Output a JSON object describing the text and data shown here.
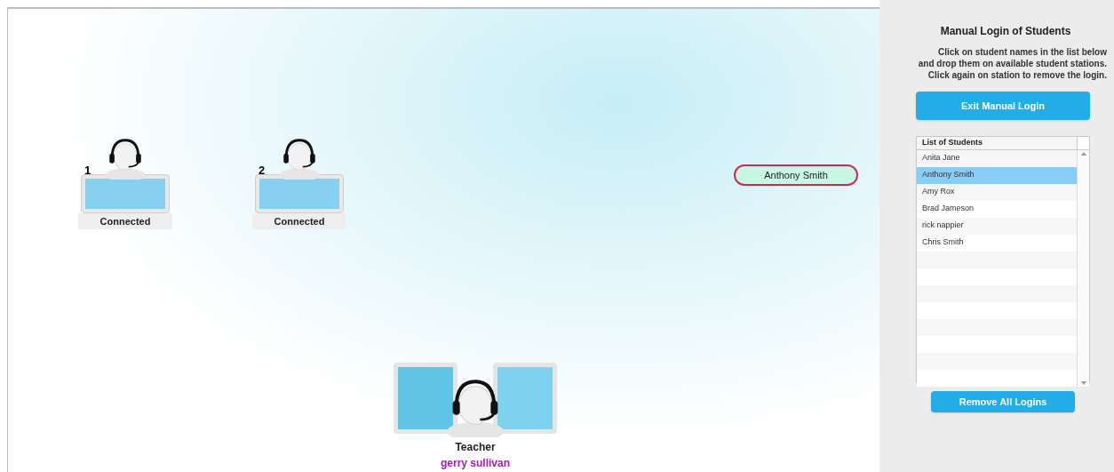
{
  "stations": [
    {
      "number": "1",
      "status": "Connected"
    },
    {
      "number": "2",
      "status": "Connected"
    }
  ],
  "drag_chip": {
    "label": "Anthony Smith"
  },
  "teacher": {
    "role": "Teacher",
    "name": "gerry sullivan"
  },
  "panel": {
    "title": "Manual Login of Students",
    "instructions": [
      "Click on student names in the list below",
      "and drop them on available student stations.",
      "Click again on station to remove the login."
    ],
    "exit_button": "Exit Manual Login",
    "list": {
      "header": "List of Students",
      "rows": [
        {
          "name": "Anita Jane",
          "selected": false
        },
        {
          "name": "Anthony Smith",
          "selected": true
        },
        {
          "name": "Amy Rox",
          "selected": false
        },
        {
          "name": "Brad Jameson",
          "selected": false
        },
        {
          "name": "rick nappier",
          "selected": false
        },
        {
          "name": "Chris Smith",
          "selected": false
        }
      ]
    },
    "remove_button": "Remove All Logins"
  }
}
